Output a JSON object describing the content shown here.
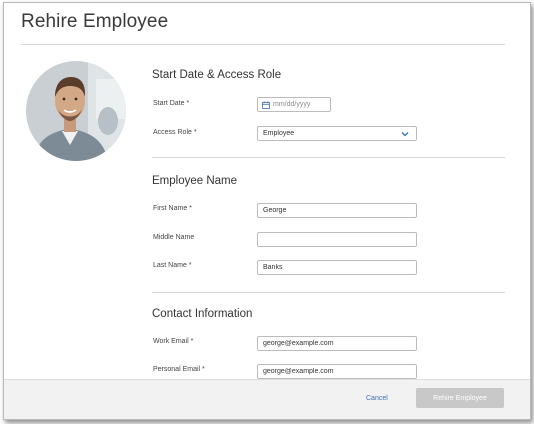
{
  "modal": {
    "title": "Rehire Employee"
  },
  "sections": {
    "start": {
      "title": "Start Date & Access Role",
      "start_date_label": "Start Date *",
      "start_date_placeholder": "mm/dd/yyyy",
      "access_role_label": "Access Role *",
      "access_role_value": "Employee"
    },
    "name": {
      "title": "Employee Name",
      "first_label": "First Name *",
      "first_value": "George",
      "middle_label": "Middle Name",
      "middle_value": "",
      "last_label": "Last Name *",
      "last_value": "Banks"
    },
    "contact": {
      "title": "Contact Information",
      "work_label": "Work Email *",
      "work_value": "george@example.com",
      "personal_label": "Personal Email *",
      "personal_value": "george@example.com"
    }
  },
  "footer": {
    "cancel_label": "Cancel",
    "submit_label": "Rehire Employee"
  },
  "colors": {
    "link": "#3f6fb5",
    "submit_disabled": "#c8c8c8",
    "icon": "#3d6db5"
  },
  "icons": {
    "calendar": "calendar-icon",
    "chevron": "chevron-down-icon"
  }
}
